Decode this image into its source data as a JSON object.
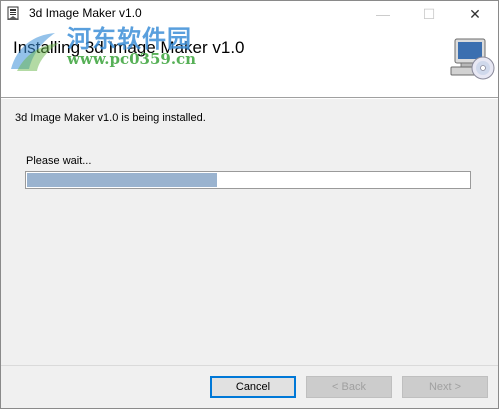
{
  "window": {
    "title": "3d Image Maker v1.0",
    "controls": {
      "minimize": "—",
      "maximize": "☐",
      "close": "✕"
    }
  },
  "header": {
    "title": "Installing 3d Image Maker v1.0",
    "graphic_icon": "computer-cd-icon"
  },
  "watermark": {
    "name": "河东软件园",
    "url": "www.pc0359.cn"
  },
  "content": {
    "status": "3d Image Maker v1.0 is being installed.",
    "wait_label": "Please wait...",
    "progress": 0.43,
    "progress_color": "#9ab3cf"
  },
  "buttons": {
    "cancel": "Cancel",
    "back": "< Back",
    "next": "Next >"
  }
}
